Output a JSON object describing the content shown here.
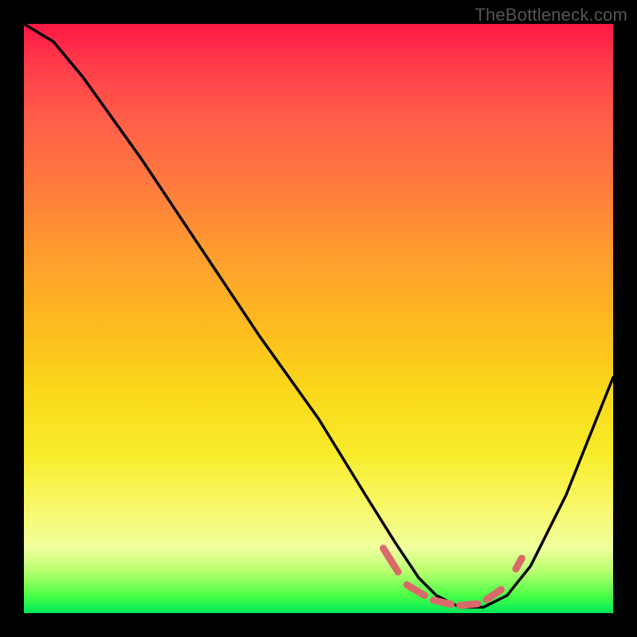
{
  "watermark": "TheBottleneck.com",
  "chart_data": {
    "type": "line",
    "title": "",
    "xlabel": "",
    "ylabel": "",
    "xlim": [
      0,
      100
    ],
    "ylim": [
      0,
      100
    ],
    "grid": false,
    "gradient_meaning": "background vertical gradient, red (high/bad) at top to green (low/good) at bottom",
    "series": [
      {
        "name": "curve",
        "stroke": "#000000",
        "x": [
          0,
          5,
          10,
          20,
          30,
          40,
          50,
          58,
          63,
          67,
          70,
          74,
          78,
          82,
          86,
          92,
          100
        ],
        "y": [
          100,
          97,
          91,
          77,
          62,
          47,
          33,
          20,
          12,
          6,
          3,
          1,
          1,
          3,
          8,
          20,
          40
        ]
      }
    ],
    "annotations": [
      {
        "name": "marker-band",
        "type": "dashed-segments",
        "color": "#d86a6a",
        "segments": [
          {
            "x0": 61,
            "y0": 11,
            "x1": 63.5,
            "y1": 7
          },
          {
            "x0": 65,
            "y0": 4.8,
            "x1": 68,
            "y1": 3
          },
          {
            "x0": 69.5,
            "y0": 2.2,
            "x1": 72.5,
            "y1": 1.5
          },
          {
            "x0": 74,
            "y0": 1.3,
            "x1": 77,
            "y1": 1.6
          },
          {
            "x0": 78.5,
            "y0": 2.3,
            "x1": 81,
            "y1": 4
          },
          {
            "x0": 83.5,
            "y0": 7.5,
            "x1": 84.5,
            "y1": 9.3
          }
        ]
      }
    ]
  }
}
